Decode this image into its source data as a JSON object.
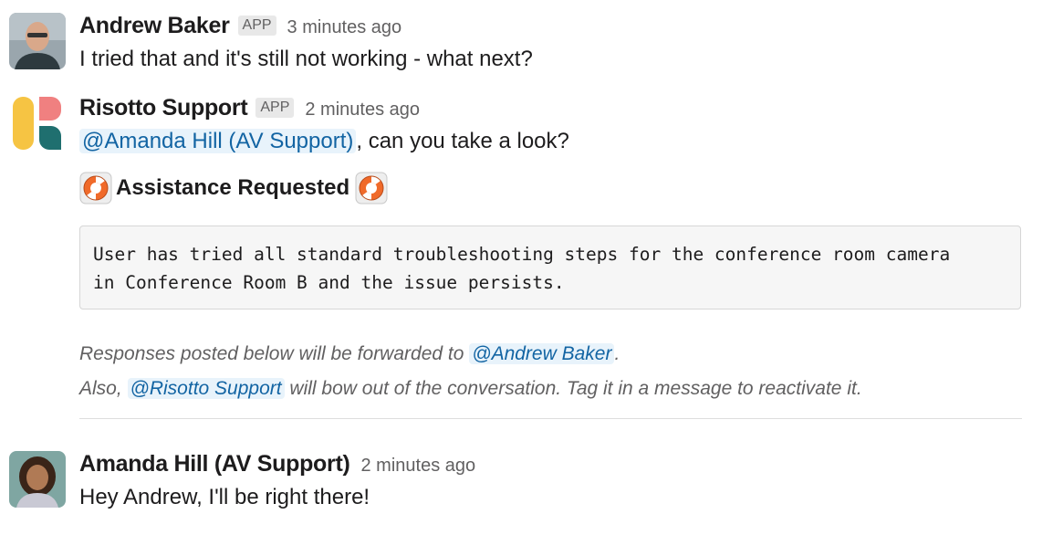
{
  "messages": [
    {
      "author": "Andrew Baker",
      "badge": "APP",
      "time": "3 minutes ago",
      "text": "I tried that and it's still not working - what next?"
    },
    {
      "author": "Risotto Support",
      "badge": "APP",
      "time": "2 minutes ago",
      "mention": "@Amanda Hill (AV Support)",
      "text_after_mention": ", can you take a look?",
      "block_title": "Assistance Requested",
      "code": "User has tried all standard troubleshooting steps for the conference room camera\nin Conference Room B and the issue persists.",
      "context_line1_prefix": "Responses posted below will be forwarded to ",
      "context_line1_mention": "@Andrew Baker",
      "context_line1_suffix": ".",
      "context_line2_prefix": "Also, ",
      "context_line2_mention": "@Risotto Support",
      "context_line2_suffix": " will bow out of the conversation. Tag it in a message to reactivate it."
    },
    {
      "author": "Amanda Hill (AV Support)",
      "time": "2 minutes ago",
      "text": "Hey Andrew, I'll be right there!"
    }
  ],
  "icons": {
    "buoy": "lifebuoy-icon"
  },
  "colors": {
    "mention_text": "#1264a3",
    "mention_bg": "#e8f3fb",
    "logo_yellow": "#f6c443",
    "logo_pink": "#f08080",
    "logo_teal": "#1f6f6f"
  }
}
